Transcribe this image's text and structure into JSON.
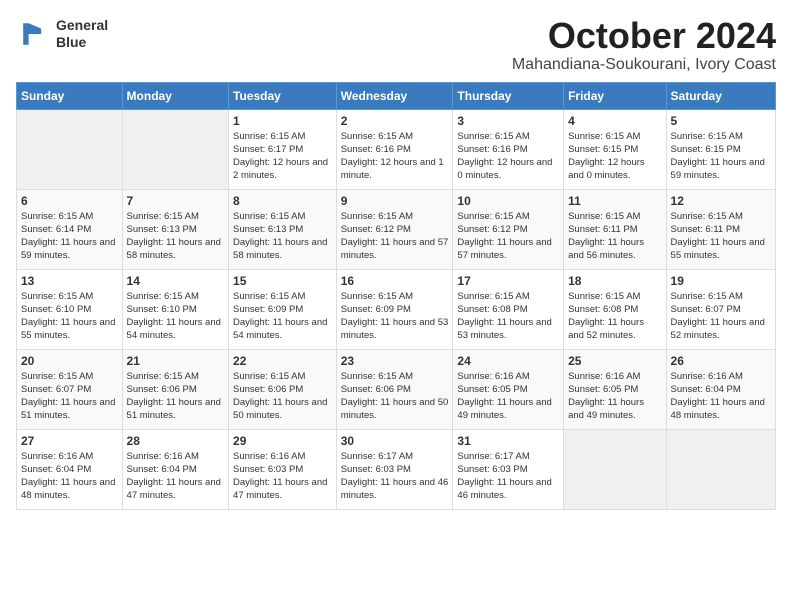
{
  "header": {
    "logo_line1": "General",
    "logo_line2": "Blue",
    "month": "October 2024",
    "location": "Mahandiana-Soukourani, Ivory Coast"
  },
  "days_of_week": [
    "Sunday",
    "Monday",
    "Tuesday",
    "Wednesday",
    "Thursday",
    "Friday",
    "Saturday"
  ],
  "weeks": [
    [
      {
        "day": "",
        "info": ""
      },
      {
        "day": "",
        "info": ""
      },
      {
        "day": "1",
        "info": "Sunrise: 6:15 AM\nSunset: 6:17 PM\nDaylight: 12 hours and 2 minutes."
      },
      {
        "day": "2",
        "info": "Sunrise: 6:15 AM\nSunset: 6:16 PM\nDaylight: 12 hours and 1 minute."
      },
      {
        "day": "3",
        "info": "Sunrise: 6:15 AM\nSunset: 6:16 PM\nDaylight: 12 hours and 0 minutes."
      },
      {
        "day": "4",
        "info": "Sunrise: 6:15 AM\nSunset: 6:15 PM\nDaylight: 12 hours and 0 minutes."
      },
      {
        "day": "5",
        "info": "Sunrise: 6:15 AM\nSunset: 6:15 PM\nDaylight: 11 hours and 59 minutes."
      }
    ],
    [
      {
        "day": "6",
        "info": "Sunrise: 6:15 AM\nSunset: 6:14 PM\nDaylight: 11 hours and 59 minutes."
      },
      {
        "day": "7",
        "info": "Sunrise: 6:15 AM\nSunset: 6:13 PM\nDaylight: 11 hours and 58 minutes."
      },
      {
        "day": "8",
        "info": "Sunrise: 6:15 AM\nSunset: 6:13 PM\nDaylight: 11 hours and 58 minutes."
      },
      {
        "day": "9",
        "info": "Sunrise: 6:15 AM\nSunset: 6:12 PM\nDaylight: 11 hours and 57 minutes."
      },
      {
        "day": "10",
        "info": "Sunrise: 6:15 AM\nSunset: 6:12 PM\nDaylight: 11 hours and 57 minutes."
      },
      {
        "day": "11",
        "info": "Sunrise: 6:15 AM\nSunset: 6:11 PM\nDaylight: 11 hours and 56 minutes."
      },
      {
        "day": "12",
        "info": "Sunrise: 6:15 AM\nSunset: 6:11 PM\nDaylight: 11 hours and 55 minutes."
      }
    ],
    [
      {
        "day": "13",
        "info": "Sunrise: 6:15 AM\nSunset: 6:10 PM\nDaylight: 11 hours and 55 minutes."
      },
      {
        "day": "14",
        "info": "Sunrise: 6:15 AM\nSunset: 6:10 PM\nDaylight: 11 hours and 54 minutes."
      },
      {
        "day": "15",
        "info": "Sunrise: 6:15 AM\nSunset: 6:09 PM\nDaylight: 11 hours and 54 minutes."
      },
      {
        "day": "16",
        "info": "Sunrise: 6:15 AM\nSunset: 6:09 PM\nDaylight: 11 hours and 53 minutes."
      },
      {
        "day": "17",
        "info": "Sunrise: 6:15 AM\nSunset: 6:08 PM\nDaylight: 11 hours and 53 minutes."
      },
      {
        "day": "18",
        "info": "Sunrise: 6:15 AM\nSunset: 6:08 PM\nDaylight: 11 hours and 52 minutes."
      },
      {
        "day": "19",
        "info": "Sunrise: 6:15 AM\nSunset: 6:07 PM\nDaylight: 11 hours and 52 minutes."
      }
    ],
    [
      {
        "day": "20",
        "info": "Sunrise: 6:15 AM\nSunset: 6:07 PM\nDaylight: 11 hours and 51 minutes."
      },
      {
        "day": "21",
        "info": "Sunrise: 6:15 AM\nSunset: 6:06 PM\nDaylight: 11 hours and 51 minutes."
      },
      {
        "day": "22",
        "info": "Sunrise: 6:15 AM\nSunset: 6:06 PM\nDaylight: 11 hours and 50 minutes."
      },
      {
        "day": "23",
        "info": "Sunrise: 6:15 AM\nSunset: 6:06 PM\nDaylight: 11 hours and 50 minutes."
      },
      {
        "day": "24",
        "info": "Sunrise: 6:16 AM\nSunset: 6:05 PM\nDaylight: 11 hours and 49 minutes."
      },
      {
        "day": "25",
        "info": "Sunrise: 6:16 AM\nSunset: 6:05 PM\nDaylight: 11 hours and 49 minutes."
      },
      {
        "day": "26",
        "info": "Sunrise: 6:16 AM\nSunset: 6:04 PM\nDaylight: 11 hours and 48 minutes."
      }
    ],
    [
      {
        "day": "27",
        "info": "Sunrise: 6:16 AM\nSunset: 6:04 PM\nDaylight: 11 hours and 48 minutes."
      },
      {
        "day": "28",
        "info": "Sunrise: 6:16 AM\nSunset: 6:04 PM\nDaylight: 11 hours and 47 minutes."
      },
      {
        "day": "29",
        "info": "Sunrise: 6:16 AM\nSunset: 6:03 PM\nDaylight: 11 hours and 47 minutes."
      },
      {
        "day": "30",
        "info": "Sunrise: 6:17 AM\nSunset: 6:03 PM\nDaylight: 11 hours and 46 minutes."
      },
      {
        "day": "31",
        "info": "Sunrise: 6:17 AM\nSunset: 6:03 PM\nDaylight: 11 hours and 46 minutes."
      },
      {
        "day": "",
        "info": ""
      },
      {
        "day": "",
        "info": ""
      }
    ]
  ]
}
